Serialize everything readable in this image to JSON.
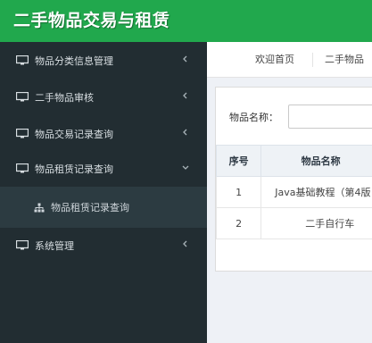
{
  "app": {
    "title": "二手物品交易与租赁"
  },
  "sidebar": {
    "items": [
      {
        "label": "物品分类信息管理",
        "icon": "monitor-icon",
        "expanded": false
      },
      {
        "label": "二手物品审核",
        "icon": "monitor-icon",
        "expanded": false
      },
      {
        "label": "物品交易记录查询",
        "icon": "monitor-icon",
        "expanded": false
      },
      {
        "label": "物品租赁记录查询",
        "icon": "monitor-icon",
        "expanded": true
      },
      {
        "label": "系统管理",
        "icon": "monitor-icon",
        "expanded": false
      }
    ],
    "submenu": [
      {
        "label": "物品租赁记录查询",
        "icon": "sitemap-icon"
      }
    ]
  },
  "tabs": [
    {
      "label": "欢迎首页"
    },
    {
      "label": "二手物品"
    }
  ],
  "search": {
    "label": "物品名称：",
    "value": ""
  },
  "table": {
    "columns": [
      "序号",
      "物品名称"
    ],
    "rows": [
      {
        "index": "1",
        "name": "Java基础教程（第4版"
      },
      {
        "index": "2",
        "name": "二手自行车"
      }
    ]
  },
  "colors": {
    "header": "#21a84d",
    "sidebar": "#222d32",
    "submenu": "#2c3b41"
  }
}
